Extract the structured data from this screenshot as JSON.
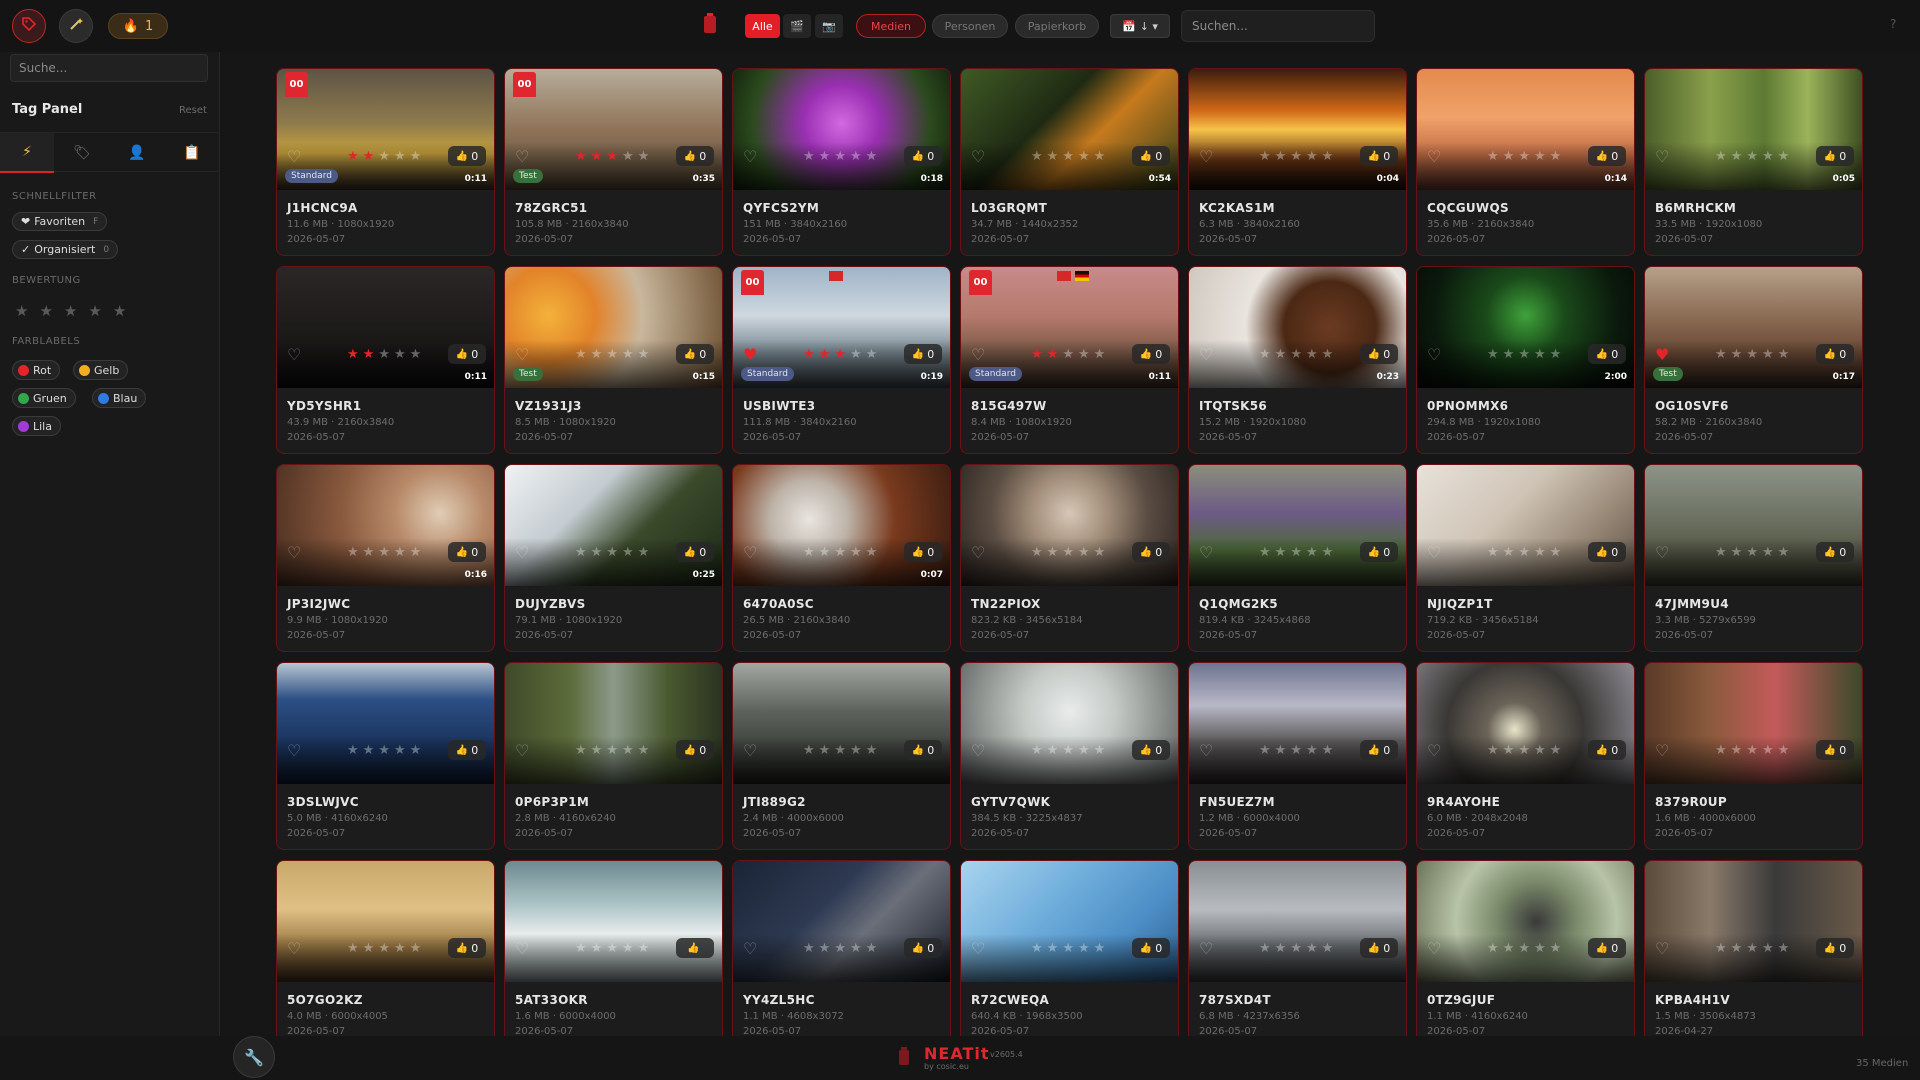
{
  "topbar": {
    "streak": "1",
    "filter_all": "Alle",
    "tab_media": "Medien",
    "tab_people": "Personen",
    "tab_trash": "Papierkorb",
    "date_sort": "↓ ▾",
    "search_placeholder": "Suchen...",
    "help": "?"
  },
  "sidebar": {
    "search_placeholder": "Suche...",
    "title": "Tag Panel",
    "reset": "Reset",
    "quickfilter_label": "SCHNELLFILTER",
    "favorites": "Favoriten",
    "favorites_key": "F",
    "organized": "Organisiert",
    "organized_count": "0",
    "rating_label": "BEWERTUNG",
    "colors_label": "FARBLABELS",
    "colors": [
      {
        "name": "Rot",
        "color": "#e3242b"
      },
      {
        "name": "Gelb",
        "color": "#f2b01e"
      },
      {
        "name": "Gruen",
        "color": "#31a84a"
      },
      {
        "name": "Blau",
        "color": "#2f7be0"
      },
      {
        "name": "Lila",
        "color": "#a13bd6"
      }
    ]
  },
  "cards": [
    {
      "name": "J1HCNC9A",
      "meta": "11.6 MB · 1080x1920",
      "date": "2026-05-07",
      "duration": "0:11",
      "likes": "0",
      "rating": 2,
      "fav": false,
      "badge": "00",
      "tag": "Standard",
      "bg": "linear-gradient(180deg,#5e5446 0%,#8e7b4c 45%,#c9a33d 70%,#3a2f24 100%)"
    },
    {
      "name": "78ZGRC51",
      "meta": "105.8 MB · 2160x3840",
      "date": "2026-05-07",
      "duration": "0:35",
      "likes": "0",
      "rating": 3,
      "fav": false,
      "badge": "00",
      "tag": "Test",
      "bg": "linear-gradient(180deg,#b7ad9a 0%,#8f7358 50%,#5a4a37 100%)"
    },
    {
      "name": "QYFCS2YM",
      "meta": "151 MB · 3840x2160",
      "date": "2026-05-07",
      "duration": "0:18",
      "likes": "0",
      "rating": 0,
      "fav": false,
      "badge": "",
      "tag": "",
      "bg": "radial-gradient(circle at 50% 45%,#d36ae0 0%,#9a2fb3 30%,#2b4a1d 70%,#12200d 100%)"
    },
    {
      "name": "L03GRQMT",
      "meta": "34.7 MB · 1440x2352",
      "date": "2026-05-07",
      "duration": "0:54",
      "likes": "0",
      "rating": 0,
      "fav": false,
      "badge": "",
      "tag": "",
      "bg": "linear-gradient(135deg,#3f5a25 0%,#1e2a13 40%,#c67a1e 60%,#2f3f1a 100%)"
    },
    {
      "name": "KC2KAS1M",
      "meta": "6.3 MB · 3840x2160",
      "date": "2026-05-07",
      "duration": "0:04",
      "likes": "0",
      "rating": 0,
      "fav": false,
      "badge": "",
      "tag": "",
      "bg": "linear-gradient(180deg,#3b1d0e 0%,#d36a18 35%,#f7c34a 50%,#6b3614 75%,#1d0f08 100%)"
    },
    {
      "name": "CQCGUWQS",
      "meta": "35.6 MB · 2160x3840",
      "date": "2026-05-07",
      "duration": "0:14",
      "likes": "0",
      "rating": 0,
      "fav": false,
      "badge": "",
      "tag": "",
      "bg": "linear-gradient(180deg,#e48a4d 0%,#f0a26a 40%,#c36f47 70%,#6b3b2c 100%)"
    },
    {
      "name": "B6MRHCKM",
      "meta": "33.5 MB · 1920x1080",
      "date": "2026-05-07",
      "duration": "0:05",
      "likes": "0",
      "rating": 0,
      "fav": false,
      "badge": "",
      "tag": "",
      "bg": "linear-gradient(90deg,#4b5e2a 0%,#8aa04b 30%,#5d7a33 55%,#9bb35a 75%,#3e4f22 100%)"
    },
    {
      "name": "YD5YSHR1",
      "meta": "43.9 MB · 2160x3840",
      "date": "2026-05-07",
      "duration": "0:11",
      "likes": "0",
      "rating": 2,
      "fav": false,
      "badge": "",
      "tag": "",
      "bg": "linear-gradient(180deg,#2a2726 0%,#1b1918 60%,#100f0e 100%)"
    },
    {
      "name": "VZ1931J3",
      "meta": "8.5 MB · 1080x1920",
      "date": "2026-05-07",
      "duration": "0:15",
      "likes": "0",
      "rating": 0,
      "fav": false,
      "badge": "",
      "tag": "Test",
      "bg": "radial-gradient(circle at 20% 40%,#f4b23a 0%,#e2832a 25%,#c9b79d 50%,#6a4d2e 100%)"
    },
    {
      "name": "USBIWTE3",
      "meta": "111.8 MB · 3840x2160",
      "date": "2026-05-07",
      "duration": "0:19",
      "likes": "0",
      "rating": 3,
      "fav": true,
      "badge": "00",
      "tag": "Standard",
      "bg": "linear-gradient(180deg,#9fb4c8 0%,#cfd8df 40%,#7a8a93 70%,#3f4a50 100%)"
    },
    {
      "name": "815G497W",
      "meta": "8.4 MB · 1080x1920",
      "date": "2026-05-07",
      "duration": "0:11",
      "likes": "0",
      "rating": 2,
      "fav": false,
      "badge": "00",
      "tag": "Standard",
      "bg": "linear-gradient(180deg,#c98a8a 0%,#b57a6d 40%,#7d5a48 70%,#3f2f26 100%)"
    },
    {
      "name": "ITQTSK56",
      "meta": "15.2 MB · 1920x1080",
      "date": "2026-05-07",
      "duration": "0:23",
      "likes": "0",
      "rating": 0,
      "fav": false,
      "badge": "",
      "tag": "",
      "bg": "radial-gradient(circle at 65% 50%,#6b3b22 0%,#4b2814 30%,#e9e4de 55%,#cfc8bf 100%)"
    },
    {
      "name": "0PNOMMX6",
      "meta": "294.8 MB · 1920x1080",
      "date": "2026-05-07",
      "duration": "2:00",
      "likes": "0",
      "rating": 0,
      "fav": false,
      "badge": "",
      "tag": "",
      "bg": "radial-gradient(circle at 50% 40%,#3fa23a 0%,#1a4a1a 30%,#0b1a0c 70%,#050a05 100%)"
    },
    {
      "name": "OG10SVF6",
      "meta": "58.2 MB · 2160x3840",
      "date": "2026-05-07",
      "duration": "0:17",
      "likes": "0",
      "rating": 0,
      "fav": true,
      "badge": "",
      "tag": "Test",
      "bg": "linear-gradient(180deg,#b7a08a 0%,#8c6d55 40%,#6b4a36 70%,#3a2a20 100%)"
    },
    {
      "name": "JP3I2JWC",
      "meta": "9.9 MB · 1080x1920",
      "date": "2026-05-07",
      "duration": "0:16",
      "likes": "0",
      "rating": 0,
      "fav": false,
      "badge": "",
      "tag": "",
      "bg": "radial-gradient(circle at 75% 40%,#e0cdb5 0%,#b88a6a 25%,#8a5a3e 55%,#4a2e20 100%)"
    },
    {
      "name": "DUJYZBVS",
      "meta": "79.1 MB · 1080x1920",
      "date": "2026-05-07",
      "duration": "0:25",
      "likes": "0",
      "rating": 0,
      "fav": false,
      "badge": "",
      "tag": "",
      "bg": "linear-gradient(135deg,#f0f2f3 0%,#c3ccd1 35%,#3a4a2a 60%,#1e2a18 100%)"
    },
    {
      "name": "6470A0SC",
      "meta": "26.5 MB · 2160x3840",
      "date": "2026-05-07",
      "duration": "0:07",
      "likes": "0",
      "rating": 0,
      "fav": false,
      "badge": "",
      "tag": "",
      "bg": "radial-gradient(circle at 35% 45%,#e9e5e0 0%,#bdb3a8 25%,#7a3a1e 55%,#3a1d10 100%)"
    },
    {
      "name": "TN22PIOX",
      "meta": "823.2 KB · 3456x5184",
      "date": "2026-05-07",
      "duration": "",
      "likes": "0",
      "rating": 0,
      "fav": false,
      "badge": "",
      "tag": "",
      "bg": "radial-gradient(circle at 50% 40%,#d6c7b6 0%,#a08c78 30%,#5a4c42 60%,#2a2420 100%)"
    },
    {
      "name": "Q1QMG2K5",
      "meta": "819.4 KB · 3245x4868",
      "date": "2026-05-07",
      "duration": "",
      "likes": "0",
      "rating": 0,
      "fav": false,
      "badge": "",
      "tag": "",
      "bg": "linear-gradient(180deg,#8a8f7a 0%,#6d5a86 40%,#4d6a3a 70%,#2c3a20 100%)"
    },
    {
      "name": "NJIQZP1T",
      "meta": "719.2 KB · 3456x5184",
      "date": "2026-05-07",
      "duration": "",
      "likes": "0",
      "rating": 0,
      "fav": false,
      "badge": "",
      "tag": "",
      "bg": "linear-gradient(135deg,#e8e2da 0%,#cfc4b6 40%,#9a8a78 70%,#5a4e44 100%)"
    },
    {
      "name": "47JMM9U4",
      "meta": "3.3 MB · 5279x6599",
      "date": "2026-05-07",
      "duration": "",
      "likes": "0",
      "rating": 0,
      "fav": false,
      "badge": "",
      "tag": "",
      "bg": "linear-gradient(180deg,#8e9388 0%,#6f7566 40%,#575a48 70%,#3a3b2e 100%)"
    },
    {
      "name": "3DSLWJVC",
      "meta": "5.0 MB · 4160x6240",
      "date": "2026-05-07",
      "duration": "",
      "likes": "0",
      "rating": 0,
      "fav": false,
      "badge": "",
      "tag": "",
      "bg": "linear-gradient(180deg,#b8c5d2 0%,#2c4f84 30%,#1b3560 65%,#0f1e38 100%)"
    },
    {
      "name": "0P6P3P1M",
      "meta": "2.8 MB · 4160x6240",
      "date": "2026-05-07",
      "duration": "",
      "likes": "0",
      "rating": 0,
      "fav": false,
      "badge": "",
      "tag": "",
      "bg": "linear-gradient(90deg,#3e4a2a 0%,#5c6b3a 30%,#8c9a8a 50%,#4a5a30 75%,#2a3320 100%)"
    },
    {
      "name": "JTI889G2",
      "meta": "2.4 MB · 4000x6000",
      "date": "2026-05-07",
      "duration": "",
      "likes": "0",
      "rating": 0,
      "fav": false,
      "badge": "",
      "tag": "",
      "bg": "linear-gradient(180deg,#a2a7a2 0%,#5e625c 40%,#3e423c 70%,#22251f 100%)"
    },
    {
      "name": "GYTV7QWK",
      "meta": "384.5 KB · 3225x4837",
      "date": "2026-05-07",
      "duration": "",
      "likes": "0",
      "rating": 0,
      "fav": false,
      "badge": "",
      "tag": "",
      "bg": "radial-gradient(circle at 50% 40%,#e9ecea 0%,#c5cac7 35%,#8c918e 70%,#5a5e5c 100%)"
    },
    {
      "name": "FN5UEZ7M",
      "meta": "1.2 MB · 6000x4000",
      "date": "2026-05-07",
      "duration": "",
      "likes": "0",
      "rating": 0,
      "fav": false,
      "badge": "",
      "tag": "",
      "bg": "linear-gradient(180deg,#6d7390 0%,#b8b8c7 35%,#5b5a5a 65%,#2e2a28 100%)"
    },
    {
      "name": "9R4AYOHE",
      "meta": "6.0 MB · 2048x2048",
      "date": "2026-05-07",
      "duration": "",
      "likes": "0",
      "rating": 0,
      "fav": false,
      "badge": "",
      "tag": "",
      "bg": "radial-gradient(circle at 45% 55%,#e8e4c9 0%,#6a6358 20%,#3a3835 50%,#8d8b92 100%)"
    },
    {
      "name": "8379R0UP",
      "meta": "1.6 MB · 4000x6000",
      "date": "2026-05-07",
      "duration": "",
      "likes": "0",
      "rating": 0,
      "fav": false,
      "badge": "",
      "tag": "",
      "bg": "linear-gradient(90deg,#5a3a28 0%,#8a5a3c 30%,#c45a5a 60%,#3a4a2a 100%)"
    },
    {
      "name": "5O7GO2KZ",
      "meta": "4.0 MB · 6000x4005",
      "date": "2026-05-07",
      "duration": "",
      "likes": "0",
      "rating": 0,
      "fav": false,
      "badge": "",
      "tag": "",
      "bg": "linear-gradient(180deg,#c9a86a 0%,#e0c084 40%,#9c7a45 70%,#4a3520 100%)"
    },
    {
      "name": "5AT33OKR",
      "meta": "1.6 MB · 6000x4000",
      "date": "2026-05-07",
      "duration": "",
      "likes": "",
      "rating": 0,
      "fav": false,
      "badge": "",
      "tag": "",
      "bg": "linear-gradient(180deg,#6d8a90 0%,#a9c2c5 35%,#e7ecec 60%,#9aa6a6 100%)"
    },
    {
      "name": "YY4ZL5HC",
      "meta": "1.1 MB · 4608x3072",
      "date": "2026-05-07",
      "duration": "",
      "likes": "0",
      "rating": 0,
      "fav": false,
      "badge": "",
      "tag": "",
      "bg": "linear-gradient(135deg,#1a2436 0%,#2e3a52 40%,#6a6f7a 60%,#151a24 100%)"
    },
    {
      "name": "R72CWEQA",
      "meta": "640.4 KB · 1968x3500",
      "date": "2026-05-07",
      "duration": "",
      "likes": "0",
      "rating": 0,
      "fav": false,
      "badge": "",
      "tag": "",
      "bg": "linear-gradient(135deg,#a9d4ef 0%,#6faedb 40%,#4d8fc6 70%,#2f5f8e 100%)"
    },
    {
      "name": "787SXD4T",
      "meta": "6.8 MB · 4237x6356",
      "date": "2026-05-07",
      "duration": "",
      "likes": "0",
      "rating": 0,
      "fav": false,
      "badge": "",
      "tag": "",
      "bg": "linear-gradient(180deg,#8a8f94 0%,#b8bcc0 40%,#6a6e72 70%,#3a3d40 100%)"
    },
    {
      "name": "0TZ9GJUF",
      "meta": "1.1 MB · 4160x6240",
      "date": "2026-05-07",
      "duration": "",
      "likes": "0",
      "rating": 0,
      "fav": false,
      "badge": "",
      "tag": "",
      "bg": "radial-gradient(circle at 55% 50%,#3a3a3a 0%,#7a8a6a 30%,#b8c4a8 60%,#6a7458 100%)"
    },
    {
      "name": "KPBA4H1V",
      "meta": "1.5 MB · 3506x4873",
      "date": "2026-04-27",
      "duration": "",
      "likes": "0",
      "rating": 0,
      "fav": false,
      "badge": "",
      "tag": "",
      "bg": "linear-gradient(90deg,#5a4a3a 0%,#8a7a6a 30%,#3a3a3a 60%,#6a5a48 100%)"
    }
  ],
  "extra_flags": {
    "USBIWTE3": [
      "red"
    ],
    "815G497W": [
      "red",
      "de"
    ]
  },
  "footer": {
    "brand": "NEATit",
    "brand_sub": "by cosic.eu",
    "version": "v2605.4",
    "count": "35 Medien"
  }
}
